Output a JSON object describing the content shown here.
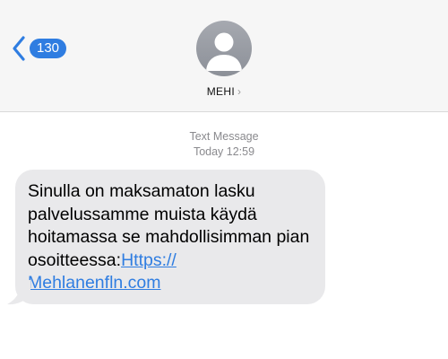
{
  "header": {
    "back_badge_count": "130",
    "contact_name": "MEHI",
    "colors": {
      "accent": "#2f7de1",
      "header_bg": "#f6f6f6",
      "bubble_bg": "#e9e9eb"
    }
  },
  "thread": {
    "service_label": "Text Message",
    "timestamp": "Today 12:59"
  },
  "message": {
    "text": "Sinulla on maksamaton lasku palvelussamme muista käydä hoitamassa se mahdollisimman pian osoitteessa:",
    "link_part1": "Https://",
    "link_part2": "Mehlanenfln.com"
  },
  "icons": [
    "chevron-left-icon",
    "person-icon",
    "chevron-right-icon"
  ]
}
